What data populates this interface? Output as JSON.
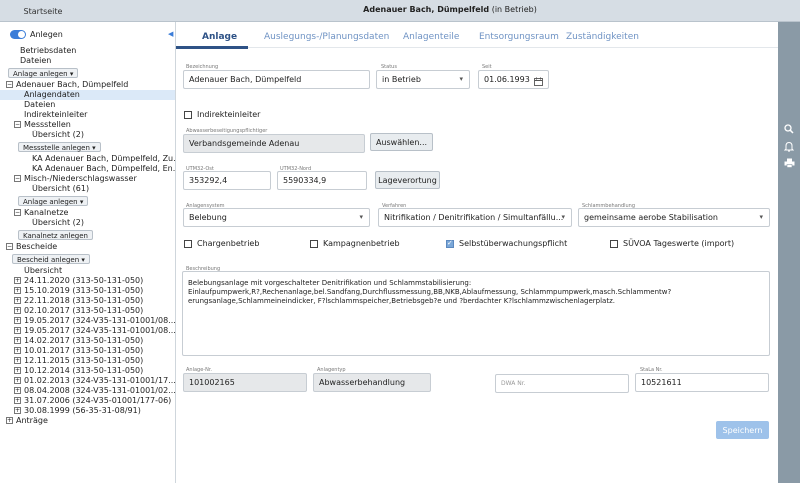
{
  "topbar": {
    "home_label": "Startseite",
    "title_bold": "Adenauer Bach, Dümpelfeld",
    "title_suffix": " (in Betrieb)"
  },
  "right_tools": {
    "icons": [
      "search-icon",
      "bell-icon",
      "printer-icon"
    ],
    "color": "#8a9aa6"
  },
  "sidebar": {
    "toggle_label": "Anlegen",
    "tree": {
      "betriebsdaten": "Betriebsdaten",
      "dateien": "Dateien",
      "anlage_anlegen": "Anlage anlegen ▾",
      "root": "Adenauer Bach, Dümpelfeld",
      "anlagendaten": "Anlagendaten",
      "dateien2": "Dateien",
      "indirekteinleiter": "Indirekteinleiter",
      "messstellen": "Messstellen",
      "messstellen_uebersicht": "Übersicht (2)",
      "messstelle_anlegen": "Messstelle anlegen ▾",
      "ka1": "KA Adenauer Bach, Dümpelfeld, Zu...",
      "ka2": "KA Adenauer Bach, Dümpelfeld, En...",
      "misch": "Misch-/Niederschlagswasser",
      "misch_uebersicht": "Übersicht (61)",
      "anlage_anlegen2": "Anlage anlegen ▾",
      "kanalnetze": "Kanalnetze",
      "kanalnetze_uebersicht": "Übersicht (2)",
      "kanalnetz_anlegen": "Kanalnetz anlegen",
      "bescheide": "Bescheide",
      "bescheid_anlegen": "Bescheid anlegen ▾",
      "bescheide_uebersicht": "Übersicht",
      "bescheide_items": [
        "24.11.2020 (313-50-131-050)",
        "15.10.2019 (313-50-131-050)",
        "22.11.2018 (313-50-131-050)",
        "02.10.2017 (313-50-131-050)",
        "19.05.2017 (324-V35-131-01001/08...",
        "19.05.2017 (324-V35-131-01001/08...",
        "14.02.2017 (313-50-131-050)",
        "10.01.2017 (313-50-131-050)",
        "12.11.2015 (313-50-131-050)",
        "10.12.2014 (313-50-131-050)",
        "01.02.2013 (324-V35-131-01001/17...",
        "08.04.2008 (324-V35-131-01001/02...",
        "31.07.2006 (324-V35-01001/177-06)",
        "30.08.1999 (56-35-31-08/91)"
      ],
      "antraege": "Anträge"
    }
  },
  "tabs": [
    "Anlage",
    "Auslegungs-/Planungsdaten",
    "Anlagenteile",
    "Entsorgungsraum",
    "Zuständigkeiten"
  ],
  "form": {
    "bezeichnung_label": "Bezeichnung",
    "bezeichnung_value": "Adenauer Bach, Dümpelfeld",
    "status_label": "Status",
    "status_value": "in Betrieb",
    "seit_label": "Seit",
    "seit_value": "01.06.1993",
    "indirekteinleiter_label": "Indirekteinleiter",
    "pflichtiger_label": "Abwasserbeseitigungspflichtiger",
    "pflichtiger_value": "Verbandsgemeinde Adenau",
    "auswaehlen_label": "Auswählen...",
    "ost_label": "UTM32-Ost",
    "ost_value": "353292,4",
    "nord_label": "UTM32-Nord",
    "nord_value": "5590334,9",
    "lageverortung_label": "Lageverortung",
    "anlagensystem_label": "Anlagensystem",
    "anlagensystem_value": "Belebung",
    "verfahren_label": "Verfahren",
    "verfahren_value": "Nitrifikation / Denitrifikation / Simultanfällu...",
    "schlamm_label": "Schlammbehandlung",
    "schlamm_value": "gemeinsame aerobe Stabilisation",
    "chargenbetrieb_label": "Chargenbetrieb",
    "kampagnenbetrieb_label": "Kampagnenbetrieb",
    "selbst_label": "Selbstüberwachungspflicht",
    "suevoa_label": "SÜVOA Tageswerte (import)",
    "beschreibung_label": "Beschreibung",
    "beschreibung_line1": "Belebungsanlage mit vorgeschalteter Denitrifikation und Schlammstabilisierung:",
    "beschreibung_line2": "Einlaufpumpwerk,R?,Rechenanlage,bel.Sandfang,Durchflussmessung,BB,NKB,Ablaufmessung, Schlammpumpwerk,masch.Schlammentw?",
    "beschreibung_line3": "erungsanlage,Schlammeineindicker, F?lschlammspeicher,Betriebsgeb?e und ?berdachter K?lschlammzwischenlagerplatz.",
    "anlage_nr_label": "Anlage-Nr.",
    "anlage_nr_value": "101002165",
    "anlagentyp_label": "Anlagentyp",
    "anlagentyp_value": "Abwasserbehandlung",
    "dwa_placeholder": "DWA Nr.",
    "stala_label": "StaLa Nr.",
    "stala_value": "10521611",
    "speichern_label": "Speichern"
  },
  "checkbox_states": {
    "indirekteinleiter": false,
    "chargenbetrieb": false,
    "kampagnenbetrieb": false,
    "selbstueberwachungspflicht": true,
    "suevoa": false
  },
  "colors": {
    "accent": "#2e5286",
    "tab_inactive": "#6f93c4",
    "selected_row": "#dbe9f8",
    "primary_button": "#9ec2ea"
  }
}
